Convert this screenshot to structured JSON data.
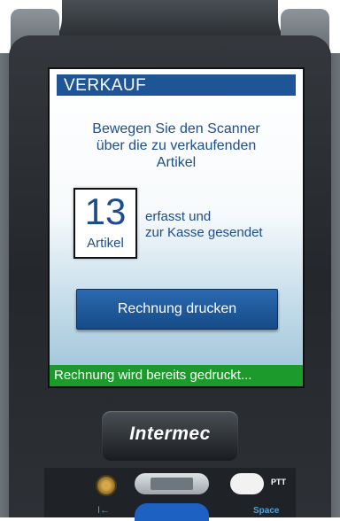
{
  "screen": {
    "title": "VERKAUF",
    "instruction_lines": [
      "Bewegen Sie den Scanner",
      "über die zu verkaufenden",
      "Artikel"
    ],
    "count_value": "13",
    "count_unit": "Artikel",
    "count_desc_lines": [
      "erfasst und",
      "zur Kasse gesendet"
    ],
    "print_button_label": "Rechnung drucken",
    "status_text": "Rechnung wird bereits gedruckt..."
  },
  "device": {
    "brand": "Intermec",
    "ptt_label": "PTT",
    "tab_label": "I←",
    "space_label": "Space"
  },
  "colors": {
    "title_bar": "#1d5596",
    "status_bar": "#1c9b2c",
    "text_blue": "#1d4e8a",
    "button": "#164b87"
  }
}
